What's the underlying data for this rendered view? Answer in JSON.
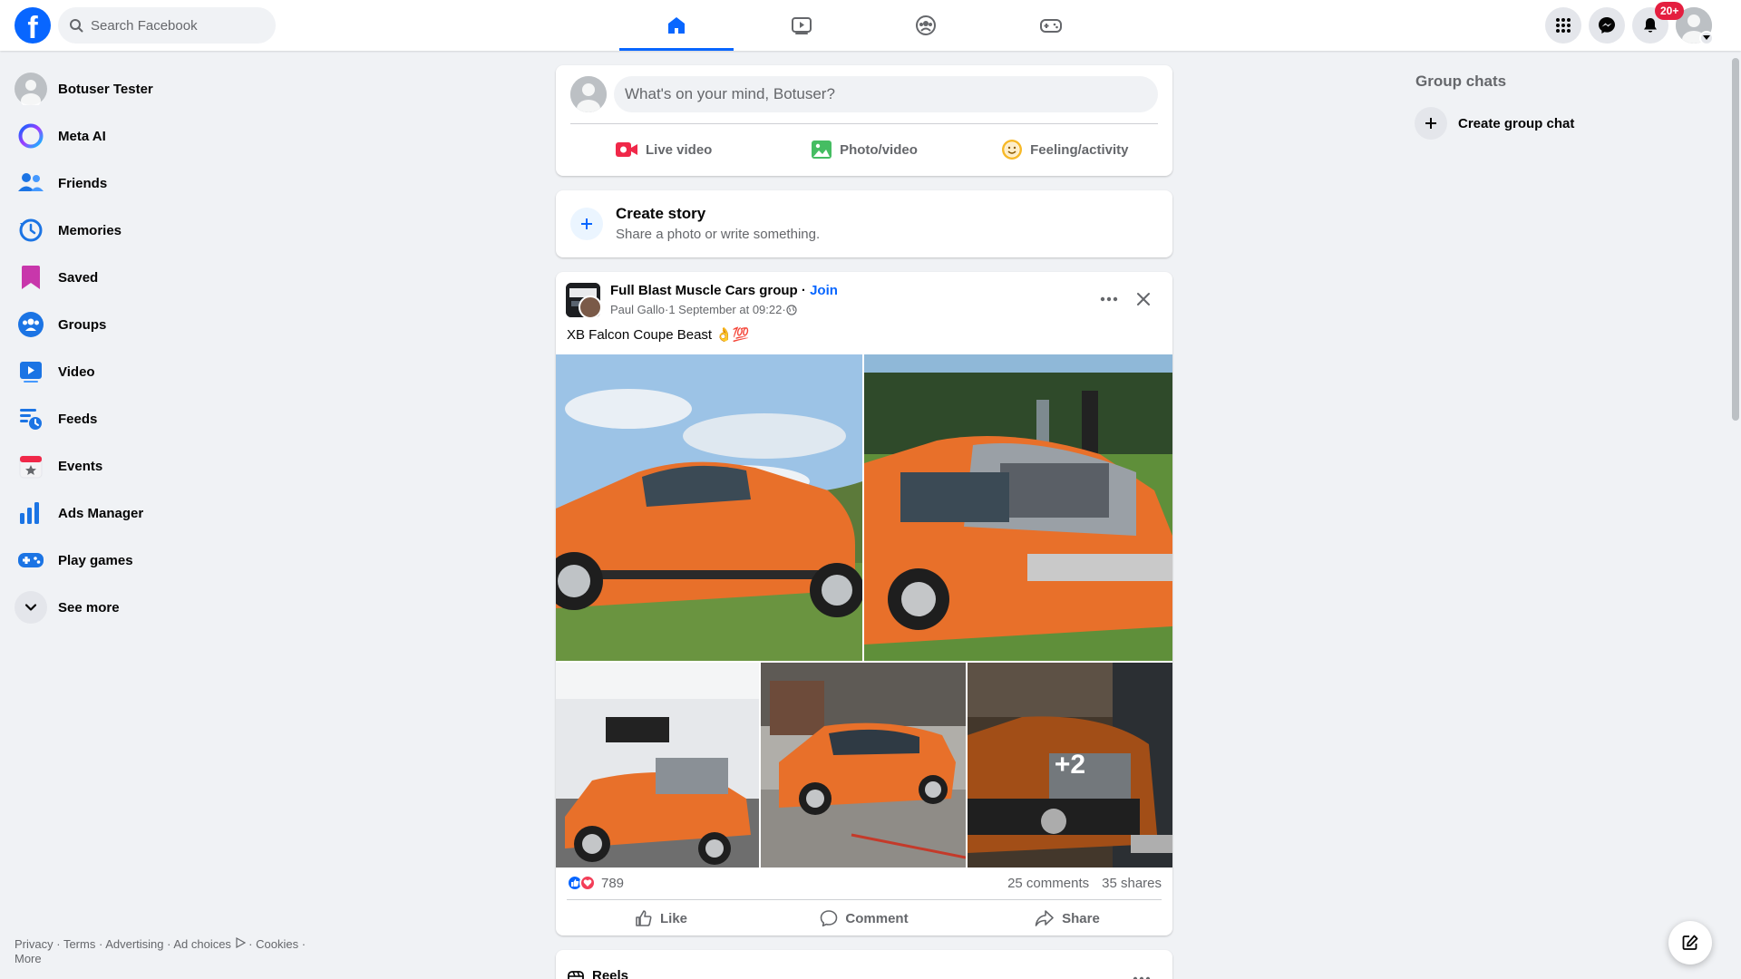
{
  "topbar": {
    "logo": "f",
    "search_placeholder": "Search Facebook",
    "tabs": [
      {
        "name": "home",
        "icon": "home-icon",
        "active": true
      },
      {
        "name": "video",
        "icon": "video-icon",
        "active": false
      },
      {
        "name": "groups",
        "icon": "groups-icon",
        "active": false
      },
      {
        "name": "gaming",
        "icon": "gaming-icon",
        "active": false
      }
    ],
    "notification_count": "20+"
  },
  "sidebar": {
    "items": [
      {
        "label": "Botuser Tester",
        "icon": "avatar-icon"
      },
      {
        "label": "Meta AI",
        "icon": "meta-ai-icon"
      },
      {
        "label": "Friends",
        "icon": "friends-icon"
      },
      {
        "label": "Memories",
        "icon": "memories-icon"
      },
      {
        "label": "Saved",
        "icon": "saved-icon"
      },
      {
        "label": "Groups",
        "icon": "groups-icon"
      },
      {
        "label": "Video",
        "icon": "video-icon"
      },
      {
        "label": "Feeds",
        "icon": "feeds-icon"
      },
      {
        "label": "Events",
        "icon": "events-icon"
      },
      {
        "label": "Ads Manager",
        "icon": "ads-manager-icon"
      },
      {
        "label": "Play games",
        "icon": "play-games-icon"
      },
      {
        "label": "See more",
        "icon": "chevron-down-icon"
      }
    ],
    "footer": {
      "privacy": "Privacy",
      "terms": "Terms",
      "advertising": "Advertising",
      "ad_choices": "Ad choices",
      "cookies": "Cookies",
      "more": "More"
    }
  },
  "composer": {
    "placeholder": "What's on your mind, Botuser?",
    "live_video": "Live video",
    "photo_video": "Photo/video",
    "feeling": "Feeling/activity"
  },
  "story": {
    "title": "Create story",
    "subtitle": "Share a photo or write something."
  },
  "post": {
    "group_name": "Full Blast Muscle Cars group",
    "separator": " · ",
    "join": "Join",
    "author": "Paul Gallo",
    "timestamp": "1 September at 09:22",
    "text": "XB Falcon Coupe Beast 👌💯",
    "more_photos": "+2",
    "reaction_count": "789",
    "comments": "25 comments",
    "shares": "35 shares",
    "like": "Like",
    "comment": "Comment",
    "share": "Share"
  },
  "reels": {
    "title": "Reels"
  },
  "right": {
    "title": "Group chats",
    "create_group": "Create group chat"
  },
  "colors": {
    "brand": "#0866ff",
    "background": "#f0f2f5",
    "badge": "#e41e3f",
    "car_orange": "#e8702a"
  }
}
